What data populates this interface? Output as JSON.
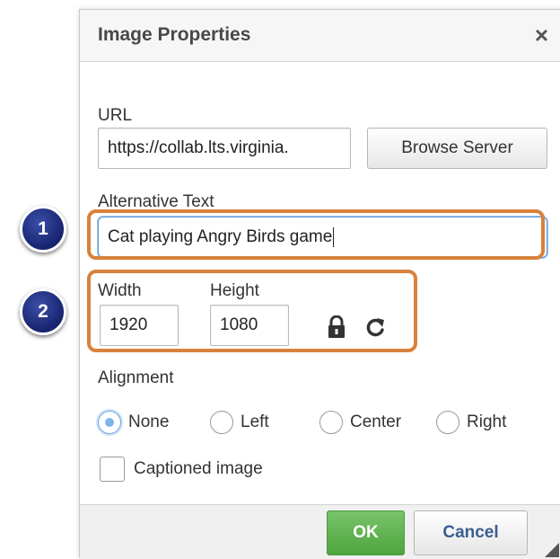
{
  "dialog": {
    "title": "Image Properties",
    "close_symbol": "×"
  },
  "url": {
    "label": "URL",
    "value": "https://collab.lts.virginia.",
    "browse_label": "Browse Server"
  },
  "alt_text": {
    "label": "Alternative Text",
    "value": "Cat playing Angry Birds game"
  },
  "dimensions": {
    "width_label": "Width",
    "width_value": "1920",
    "height_label": "Height",
    "height_value": "1080",
    "lock_icon": "lock-icon",
    "reset_icon": "reset-size-icon"
  },
  "alignment": {
    "label": "Alignment",
    "options": [
      "None",
      "Left",
      "Center",
      "Right"
    ],
    "selected": "None"
  },
  "caption": {
    "label": "Captioned image",
    "checked": false
  },
  "footer": {
    "ok_label": "OK",
    "cancel_label": "Cancel"
  },
  "annotations": {
    "badge_1": "1",
    "badge_2": "2",
    "highlight_color": "#d8823c",
    "badge_color": "#1f2c80"
  }
}
